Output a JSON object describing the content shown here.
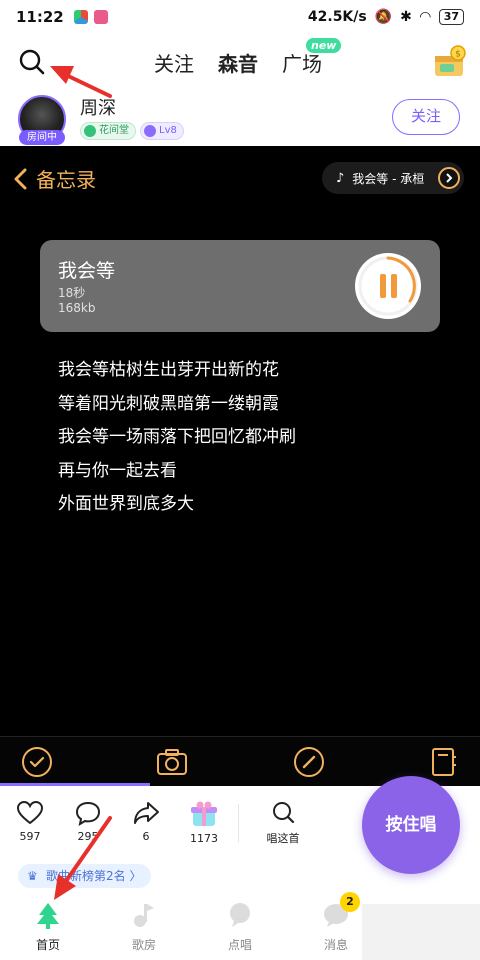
{
  "status_bar": {
    "time": "11:22",
    "network_speed": "42.5K/s",
    "battery": "37"
  },
  "top_nav": {
    "tabs": [
      {
        "label": "关注"
      },
      {
        "label": "森音"
      },
      {
        "label": "广场"
      }
    ],
    "new_badge": "new"
  },
  "user": {
    "name": "周深",
    "live_tag": "房间中",
    "hall_badge": "花间堂",
    "level_badge": "Lv8",
    "follow_label": "关注"
  },
  "memo": {
    "title": "备忘录",
    "song_pill": "我会等 - 承桓",
    "audio": {
      "title": "我会等",
      "duration": "18秒",
      "size": "168kb"
    },
    "lyrics": [
      "我会等枯树生出芽开出新的花",
      "等着阳光刺破黑暗第一缕朝霞",
      "我会等一场雨落下把回忆都冲刷",
      "再与你一起去看",
      "外面世界到底多大"
    ]
  },
  "actions": {
    "like_count": "597",
    "comment_count": "295",
    "share_count": "6",
    "gift_count": "1173",
    "sing_this_label": "唱这首",
    "hold_to_sing": "按住唱"
  },
  "rank": "歌曲新榜第2名 〉",
  "bottom_nav": [
    {
      "label": "首页"
    },
    {
      "label": "歌房"
    },
    {
      "label": "点唱"
    },
    {
      "label": "消息"
    }
  ],
  "message_badge": "2",
  "colors": {
    "accent_purple": "#8a63e8",
    "memo_gold": "#f2b25b",
    "active_green": "#3ed9b0",
    "annotation_red": "#e8302a"
  }
}
